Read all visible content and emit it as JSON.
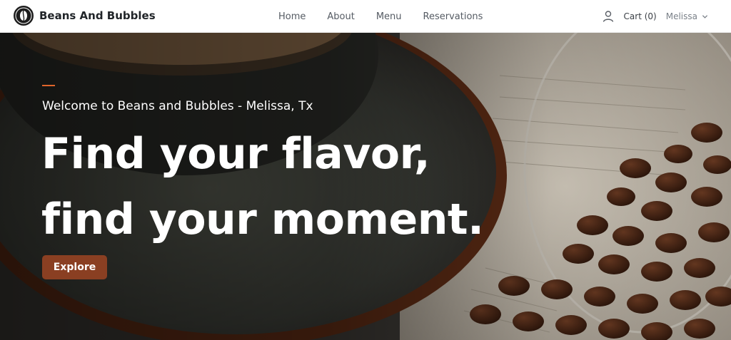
{
  "nav": {
    "brand": "Beans And Bubbles",
    "links": [
      "Home",
      "About",
      "Menu",
      "Reservations"
    ],
    "cart_label": "Cart (0)",
    "user_name": "Melissa"
  },
  "hero": {
    "welcome": "Welcome to Beans and Bubbles - Melissa, Tx",
    "headline_line1": "Find your flavor,",
    "headline_line2": "find your moment.",
    "button_label": "Explore"
  },
  "colors": {
    "accent": "#e0652a",
    "button": "#8a3f22",
    "text_dark": "#212529"
  },
  "icons": {
    "logo": "coffee-bean-logo",
    "user": "user-icon",
    "chevron": "chevron-down-icon"
  }
}
